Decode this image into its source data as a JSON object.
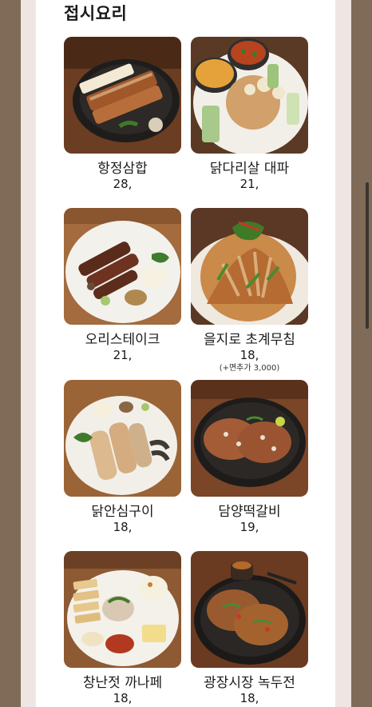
{
  "section": {
    "title": "접시요리"
  },
  "menu": [
    {
      "name": "항정삼합",
      "price": "28,",
      "note": "",
      "icon": "pork-jowl-platter-photo"
    },
    {
      "name": "닭다리살 대파",
      "price": "21,",
      "note": "",
      "icon": "chicken-thigh-scallion-photo"
    },
    {
      "name": "오리스테이크",
      "price": "21,",
      "note": "",
      "icon": "duck-steak-photo"
    },
    {
      "name": "을지로 초계무침",
      "price": "18,",
      "note": "(+면추가 3,000)",
      "icon": "cold-chicken-salad-photo"
    },
    {
      "name": "닭안심구이",
      "price": "18,",
      "note": "",
      "icon": "grilled-chicken-tenderloin-photo"
    },
    {
      "name": "담양떡갈비",
      "price": "19,",
      "note": "",
      "icon": "tteokgalbi-photo"
    },
    {
      "name": "창난젓 까나페",
      "price": "18,",
      "note": "",
      "icon": "changnanjeot-canape-photo"
    },
    {
      "name": "광장시장 녹두전",
      "price": "18,",
      "note": "",
      "icon": "mung-bean-pancake-photo"
    }
  ],
  "colors": {
    "outer_bg": "#7f6b57",
    "page_margin": "#efe6e3",
    "content_bg": "#ffffff",
    "text": "#1b1b1b"
  }
}
